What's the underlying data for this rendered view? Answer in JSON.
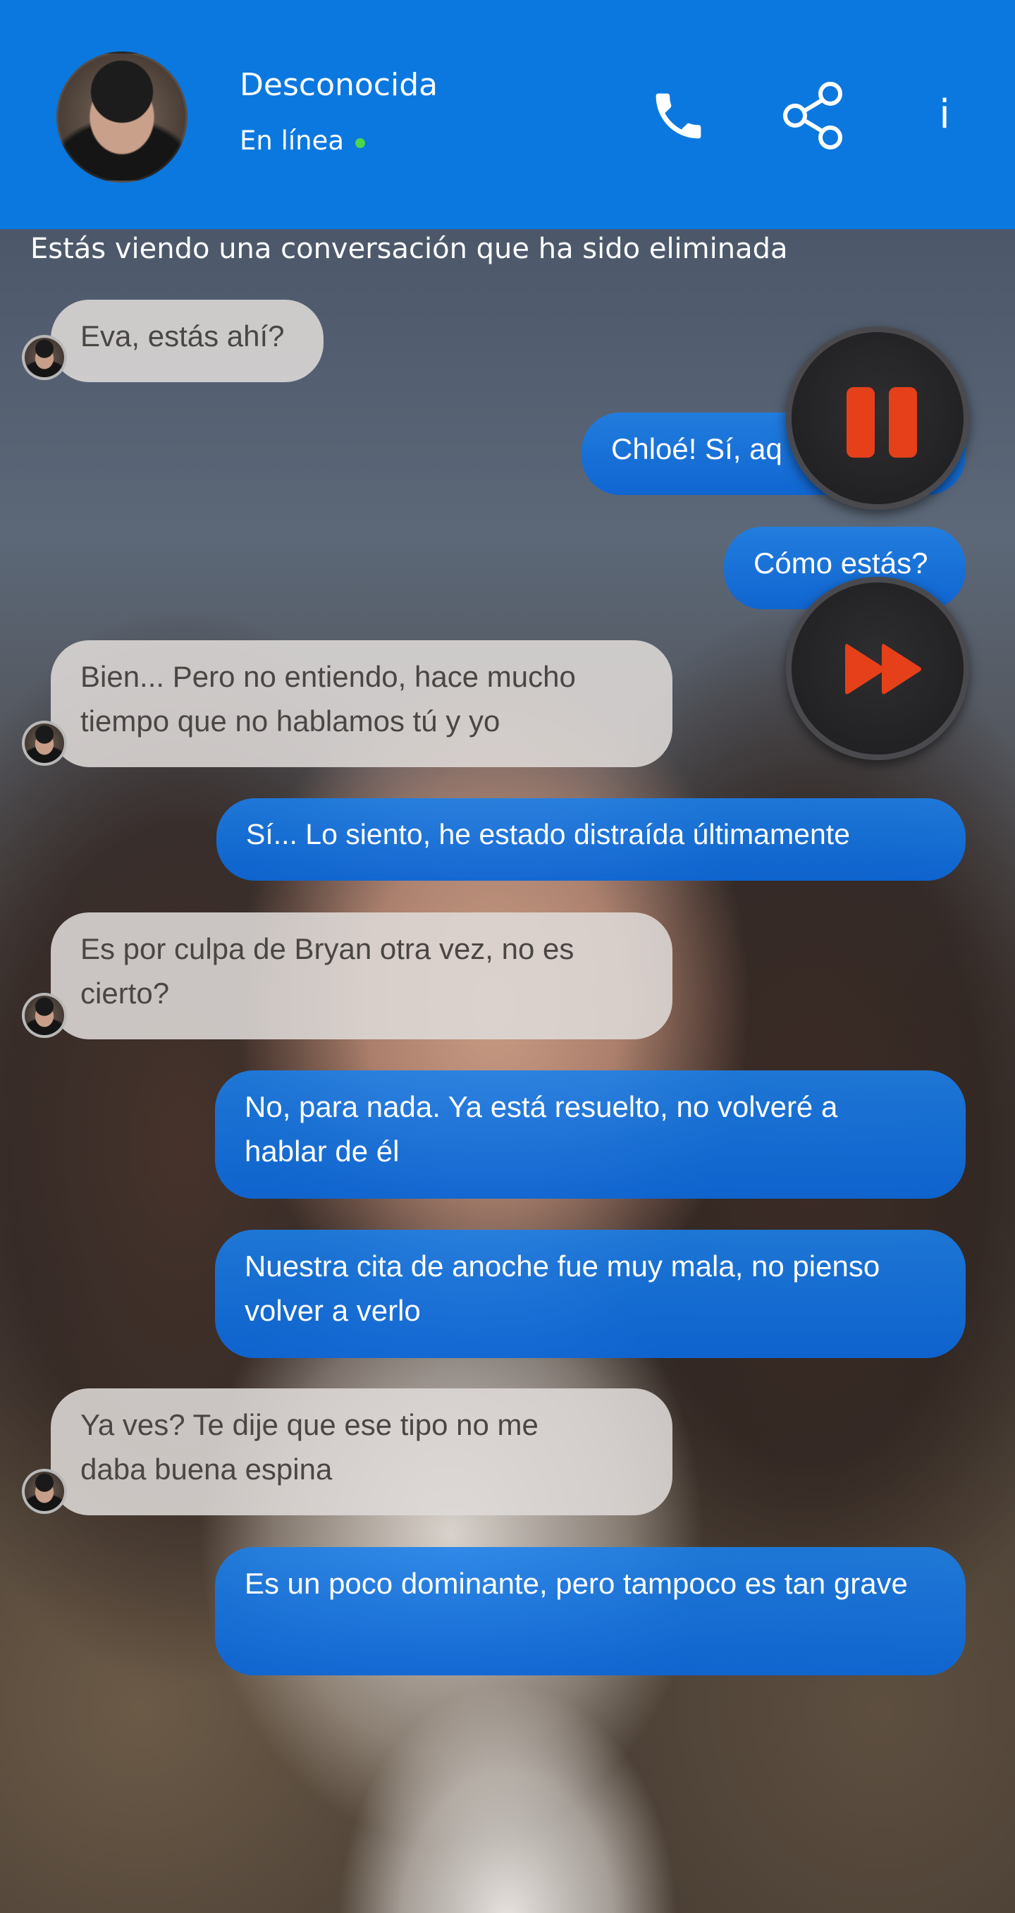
{
  "header": {
    "contact_name": "Desconocida",
    "status": "En línea",
    "info_label": "i",
    "accent_color": "#0b78df",
    "online_color": "#4cd64c",
    "icons": [
      "phone-icon",
      "share-icon",
      "info-icon"
    ]
  },
  "notice": "Estás viendo una conversación que ha sido eliminada",
  "messages": [
    {
      "from": "contact",
      "text": "Eva, estás ahí?"
    },
    {
      "from": "me",
      "text": "Chloé! Sí, aq"
    },
    {
      "from": "me",
      "text": "Cómo estás?"
    },
    {
      "from": "contact",
      "text": "Bien... Pero no entiendo, hace mucho tiempo que no hablamos tú y yo"
    },
    {
      "from": "me",
      "text": "Sí... Lo siento, he estado distraída últimamente"
    },
    {
      "from": "contact",
      "text": "Es por culpa de Bryan otra vez, no es cierto?"
    },
    {
      "from": "me",
      "text": "No, para nada. Ya está resuelto, no volveré a hablar de él"
    },
    {
      "from": "me",
      "text": "Nuestra cita de anoche fue muy mala, no pienso volver a verlo"
    },
    {
      "from": "contact",
      "text": "Ya ves? Te dije que ese tipo no me daba buena espina"
    },
    {
      "from": "me",
      "text": "Es un poco dominante, pero tampoco es tan grave"
    }
  ],
  "controls": {
    "pause_icon": "pause-icon",
    "fast_forward_icon": "fast-forward-icon",
    "icon_color": "#e5401a"
  }
}
